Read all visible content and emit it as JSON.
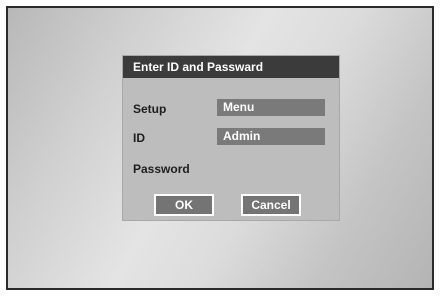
{
  "dialog": {
    "title": "Enter ID and Passward",
    "rows": [
      {
        "label": "Setup",
        "value": "Menu"
      },
      {
        "label": "ID",
        "value": "Admin"
      },
      {
        "label": "Password",
        "value": ""
      }
    ],
    "ok_label": "OK",
    "cancel_label": "Cancel"
  }
}
